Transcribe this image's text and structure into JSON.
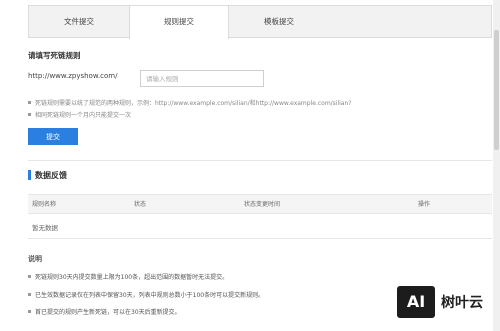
{
  "tabs": [
    {
      "label": "文件提交",
      "active": false
    },
    {
      "label": "规则提交",
      "active": true
    },
    {
      "label": "模板提交",
      "active": false
    }
  ],
  "form": {
    "title": "请填写死链规则",
    "prefix": "http://www.zpyshow.com/",
    "input_placeholder": "请输入规则",
    "input_value": "",
    "notes": [
      "死链规则需要以统了规范的两种规则，示例：http://www.example.com/silian/和http://www.example.com/silian?",
      "相同死链规则一个月内只能提交一次"
    ],
    "submit_label": "提交"
  },
  "feedback": {
    "title": "数据反馈",
    "columns": [
      "规则名称",
      "状态",
      "状态变更时间",
      "操作"
    ],
    "empty_text": "暂无数据"
  },
  "explanation": {
    "title": "说明",
    "items": [
      "死链规则30天内提交数量上限为100条，超出范围的数据暂时无法提交。",
      "已生效数据记录仅在列表中保留30天，列表中规则总数小于100条时可以提交新规则。",
      "首已提交的规则产生新死链，可以在30天后重新提交。"
    ]
  },
  "watermark": {
    "badge_text": "AI",
    "brand_text": "树叶云"
  },
  "colors": {
    "accent": "#2b7fe0",
    "tab_bg": "#f2f2f2",
    "table_head_bg": "#f5f5f5"
  }
}
